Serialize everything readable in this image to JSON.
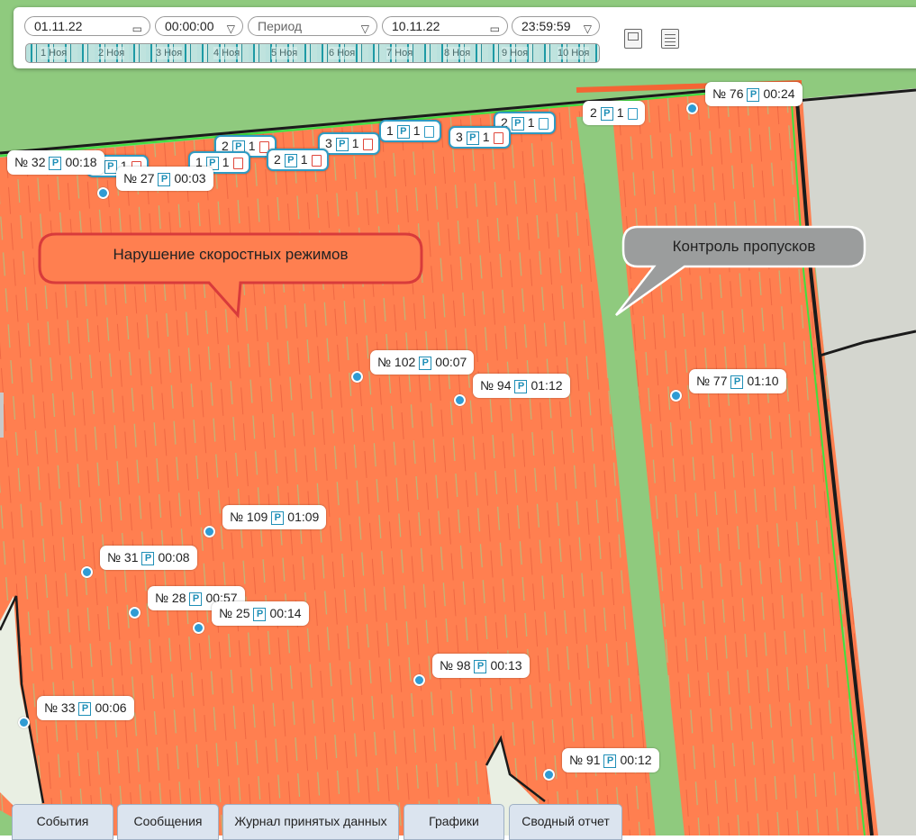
{
  "toolbar": {
    "date_from": "01.11.22",
    "time_from": "00:00:00",
    "period": "Период",
    "date_to": "10.11.22",
    "time_to": "23:59:59",
    "timeline_ticks": [
      "1 Ноя",
      "2 Ноя",
      "3 Ноя",
      "4 Ноя",
      "5 Ноя",
      "6 Ноя",
      "7 Ноя",
      "8 Ноя",
      "9 Ноя",
      "10 Ноя"
    ]
  },
  "markers": [
    {
      "id": "№ 76",
      "time": "00:24"
    },
    {
      "id": "№ 32",
      "time": "00:18"
    },
    {
      "id": "№ 27",
      "time": "00:03"
    },
    {
      "id": "№ 102",
      "time": "00:07"
    },
    {
      "id": "№ 94",
      "time": "01:12"
    },
    {
      "id": "№ 77",
      "time": "01:10"
    },
    {
      "id": "№ 109",
      "time": "01:09"
    },
    {
      "id": "№ 31",
      "time": "00:08"
    },
    {
      "id": "№ 28",
      "time": "00:57"
    },
    {
      "id": "№ 25",
      "time": "00:14"
    },
    {
      "id": "№ 98",
      "time": "00:13"
    },
    {
      "id": "№ 33",
      "time": "00:06"
    },
    {
      "id": "№ 91",
      "time": "00:12"
    }
  ],
  "clusters": [
    {
      "count": "2",
      "n": "1"
    },
    {
      "count": "3",
      "n": "1"
    },
    {
      "count": "2",
      "n": "1"
    },
    {
      "count": "3",
      "n": "1"
    },
    {
      "count": "1",
      "n": "1"
    },
    {
      "count": "2",
      "n": "1"
    },
    {
      "count": "3",
      "n": "1"
    },
    {
      "count": "2",
      "n": "1"
    },
    {
      "count": "1",
      "n": "1"
    },
    {
      "count": "2",
      "n": "1"
    }
  ],
  "callouts": {
    "speed": "Нарушение скоростных режимов",
    "gaps": "Контроль пропусков"
  },
  "tabs": [
    "События",
    "Сообщения",
    "Журнал принятых данных",
    "Графики",
    "Сводный отчет"
  ],
  "colors": {
    "field": "#ff7f50",
    "grass": "#8fca7e",
    "road": "#d4d6cf",
    "marker": "#2f9bd3",
    "tab_bg": "#dbe4ef"
  },
  "icons": [
    "calendar-icon",
    "chevron-down-icon",
    "parking-icon",
    "fuel-icon",
    "panel-icon",
    "list-icon"
  ]
}
